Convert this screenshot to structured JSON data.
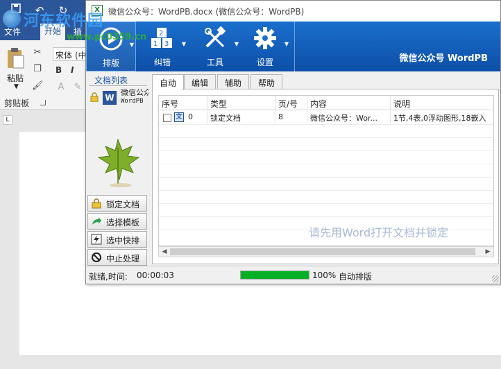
{
  "word": {
    "title_buttons": [
      "save-icon",
      "undo-icon",
      "redo-icon"
    ],
    "tabs": [
      "文件",
      "开始",
      "插"
    ],
    "ribbon": {
      "paste_label": "粘贴",
      "font_name": "宋体 (中",
      "clipboard_group": "剪贴板",
      "bold": "B",
      "italic": "I"
    },
    "ruler_corner": "L",
    "window_controls": [
      "—",
      "☐",
      "✕"
    ]
  },
  "watermark": {
    "site_name": "河东软件园",
    "url": "www.pc0359.cn"
  },
  "pb": {
    "title": "微信公众号：WordPB.docx (微信公众号：WordPB)",
    "toolbar": [
      {
        "label": "排版",
        "icon": "play-icon"
      },
      {
        "label": "纠错",
        "icon": "blocks-icon"
      },
      {
        "label": "工具",
        "icon": "tools-icon"
      },
      {
        "label": "设置",
        "icon": "gear-icon"
      }
    ],
    "brand": "微信公众号 WordPB",
    "doclist_label": "文档列表",
    "doc_entry": {
      "name": "微信公众号",
      "sub": "WordPB"
    },
    "side_buttons": [
      {
        "label": "锁定文档",
        "icon": "lock-doc-icon"
      },
      {
        "label": "选择模板",
        "icon": "arrow-icon"
      },
      {
        "label": "选中快排",
        "icon": "lightning-icon"
      },
      {
        "label": "中止处理",
        "icon": "stop-icon"
      }
    ],
    "tabs": [
      "自动",
      "编辑",
      "辅助",
      "帮助"
    ],
    "grid": {
      "headers": [
        "序号",
        "类型",
        "页/号",
        "内容",
        "说明"
      ],
      "rows": [
        {
          "index": "0",
          "type": "锁定文档",
          "page": "8",
          "content": "微信公众号：Wor...",
          "note": "1节,4表,0浮动图形,18嵌入"
        }
      ]
    },
    "hint": "请先用Word打开文档并锁定",
    "status": {
      "state": "就绪,时间:",
      "time": "00:00:03",
      "progress_percent": 100,
      "percent_text": "100%",
      "mode": "自动排版"
    }
  },
  "colors": {
    "word_blue": "#2b579a",
    "toolbar_blue": "#1a6fcc",
    "progress_green": "#06b025"
  }
}
